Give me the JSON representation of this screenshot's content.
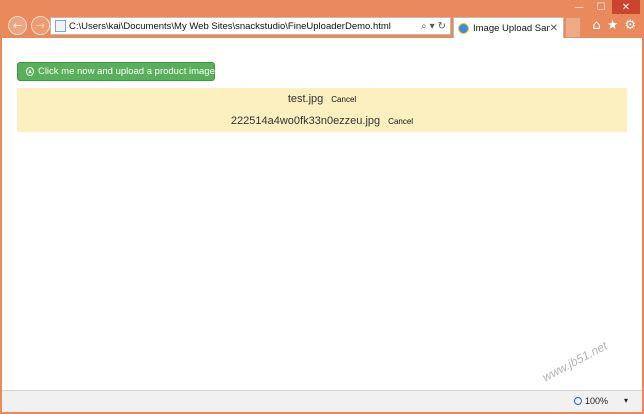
{
  "window": {
    "minimize": "—",
    "maximize": "☐",
    "close": "✕"
  },
  "nav": {
    "back": "←",
    "forward": "→",
    "address": "C:\\Users\\kai\\Documents\\My Web Sites\\snackstudio\\FineUploaderDemo.html",
    "search_icon": "⌕",
    "dropdown_icon": "▾",
    "refresh_icon": "↻"
  },
  "tab": {
    "title": "Image Upload Sam...",
    "close": "✕"
  },
  "tools": {
    "home": "⌂",
    "favorites": "★",
    "settings": "⚙"
  },
  "content": {
    "upload_button": "Click me now and upload a product image",
    "files": [
      {
        "name": "test.jpg",
        "cancel": "Cancel"
      },
      {
        "name": "222514a4wo0fk33n0ezzeu.jpg",
        "cancel": "Cancel"
      }
    ]
  },
  "statusbar": {
    "zoom": "100%",
    "caret": "▾"
  },
  "watermark": "www.jb51.net"
}
